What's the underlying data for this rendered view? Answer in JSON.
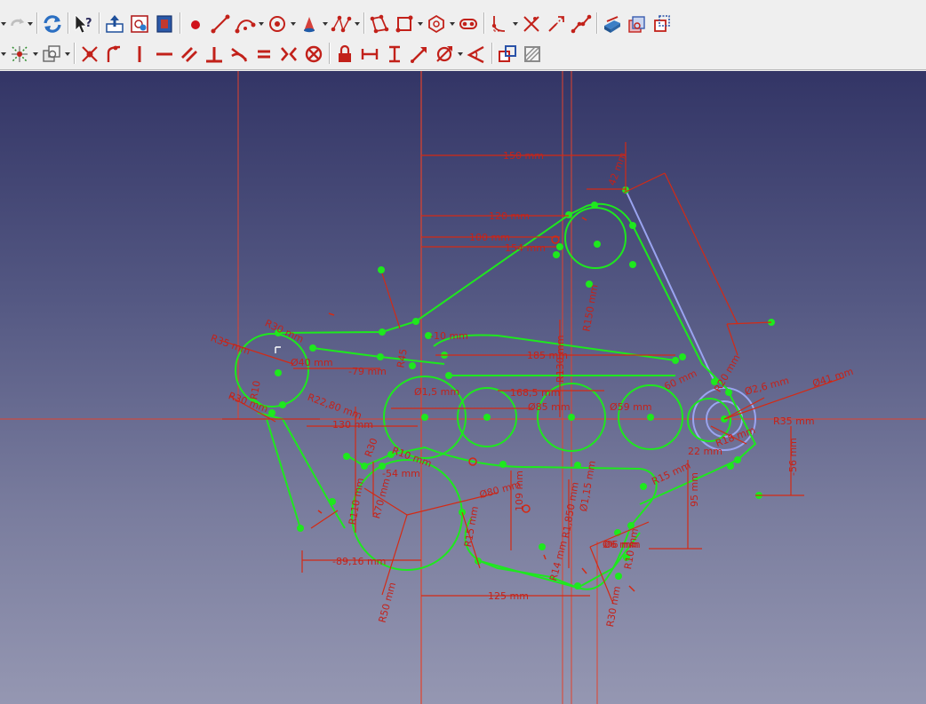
{
  "toolbar_row1": {
    "icons": [
      "dropdown-arrow",
      "redo-icon",
      "refresh-icon",
      "whats-this-icon",
      "leave-sketch-icon",
      "view-sketch-icon",
      "view-section-icon",
      "point-icon",
      "line-icon",
      "arc-icon",
      "circle-icon",
      "conic-icon",
      "bspline-icon",
      "polyline-icon",
      "rectangle-icon",
      "polygon-icon",
      "slot-icon",
      "fillet-icon",
      "trim-icon",
      "extend-icon",
      "split-icon",
      "external-geometry-icon",
      "carbon-copy-icon",
      "construction-mode-icon"
    ]
  },
  "toolbar_row2": {
    "icons": [
      "dropdown-arrow",
      "validate-sketch-icon",
      "merge-sketch-icon",
      "coincident-icon",
      "point-on-object-icon",
      "vertical-icon",
      "horizontal-icon",
      "parallel-icon",
      "perpendicular-icon",
      "tangent-icon",
      "equal-icon",
      "symmetric-icon",
      "block-icon",
      "lock-icon",
      "horizontal-distance-icon",
      "vertical-distance-icon",
      "distance-icon",
      "radius-diameter-icon",
      "angle-icon",
      "toggle-driving-icon",
      "toggle-active-icon"
    ]
  },
  "colors": {
    "geometry": "#1ee81e",
    "constraint": "#d42a14",
    "construction": "#9aa4f0",
    "axis": "#e2422c"
  },
  "dimensions": [
    "150 mm",
    "120 mm",
    "100 mm",
    "154 mm",
    "42 mm",
    "R30 mm",
    "R50 mm",
    "Ø40 mm",
    "R35 mm",
    "R30 mm",
    "R6 mm",
    "-79 mm",
    "R45",
    "-10 mm",
    "185 mm",
    "R22,80 mm",
    "130 mm",
    "R10 mm",
    "Ø1,5 mm",
    "168,5 mm",
    "Ø85 mm",
    "Ø59 mm",
    "R130 mm",
    "R150 mm",
    "R70 mm",
    "-54 mm",
    "Ø80 mm",
    "R15 mm",
    "R10 mm",
    "109 mm",
    "R1,850 mm",
    "Ø1,15 mm",
    "-89,16 mm",
    "R50 mm",
    "125 mm",
    "Ø6 mm",
    "R10 mm",
    "R15 mm",
    "R30 mm",
    "95 mm",
    "Ø2,6 mm",
    "Ø41 mm",
    "R30 mm",
    "22 mm",
    "-56 mm",
    "60 mm",
    "R35 mm",
    "R18 mm",
    "R20 mm",
    "R110 mm",
    "R10",
    "Ø6 mm",
    "R14 mm",
    "R30"
  ]
}
